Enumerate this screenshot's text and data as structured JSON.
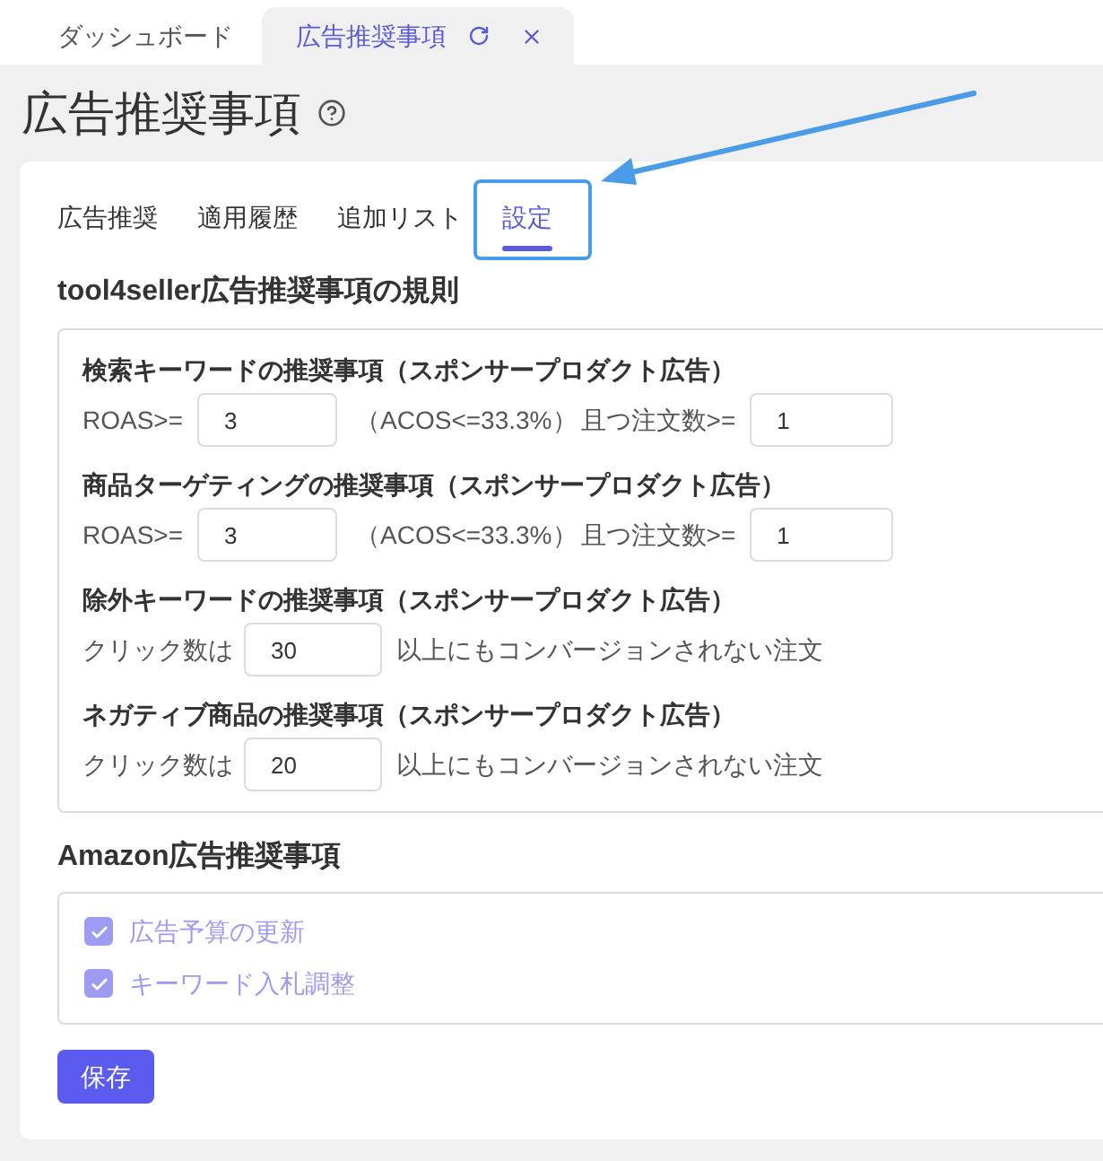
{
  "window_tabs": [
    {
      "label": "ダッシュボード",
      "selected": false
    },
    {
      "label": "広告推奨事項",
      "selected": true
    }
  ],
  "page": {
    "title": "広告推奨事項"
  },
  "tabs": [
    {
      "label": "広告推奨",
      "selected": false
    },
    {
      "label": "適用履歴",
      "selected": false
    },
    {
      "label": "追加リスト",
      "selected": false
    },
    {
      "label": "設定",
      "selected": true
    }
  ],
  "rules_section": {
    "title": "tool4seller広告推奨事項の規則",
    "groups": [
      {
        "kind": "roas",
        "title": "検索キーワードの推奨事項（スポンサープロダクト広告）",
        "roas_label": "ROAS>=",
        "roas_value": "3",
        "acos_note": "（ACOS<=33.3%）",
        "orders_label": "且つ注文数>=",
        "orders_value": "1"
      },
      {
        "kind": "roas",
        "title": "商品ターゲティングの推奨事項（スポンサープロダクト広告）",
        "roas_label": "ROAS>=",
        "roas_value": "3",
        "acos_note": "（ACOS<=33.3%）",
        "orders_label": "且つ注文数>=",
        "orders_value": "1"
      },
      {
        "kind": "clicks",
        "title": "除外キーワードの推奨事項（スポンサープロダクト広告）",
        "clicks_label": "クリック数は",
        "clicks_value": "30",
        "suffix": "以上にもコンバージョンされない注文"
      },
      {
        "kind": "clicks",
        "title": "ネガティブ商品の推奨事項（スポンサープロダクト広告）",
        "clicks_label": "クリック数は",
        "clicks_value": "20",
        "suffix": "以上にもコンバージョンされない注文"
      }
    ]
  },
  "amazon_section": {
    "title": "Amazon広告推奨事項",
    "options": [
      {
        "label": "広告予算の更新",
        "checked": true,
        "disabled": true
      },
      {
        "label": "キーワード入札調整",
        "checked": true,
        "disabled": true
      }
    ]
  },
  "save_button": "保存"
}
